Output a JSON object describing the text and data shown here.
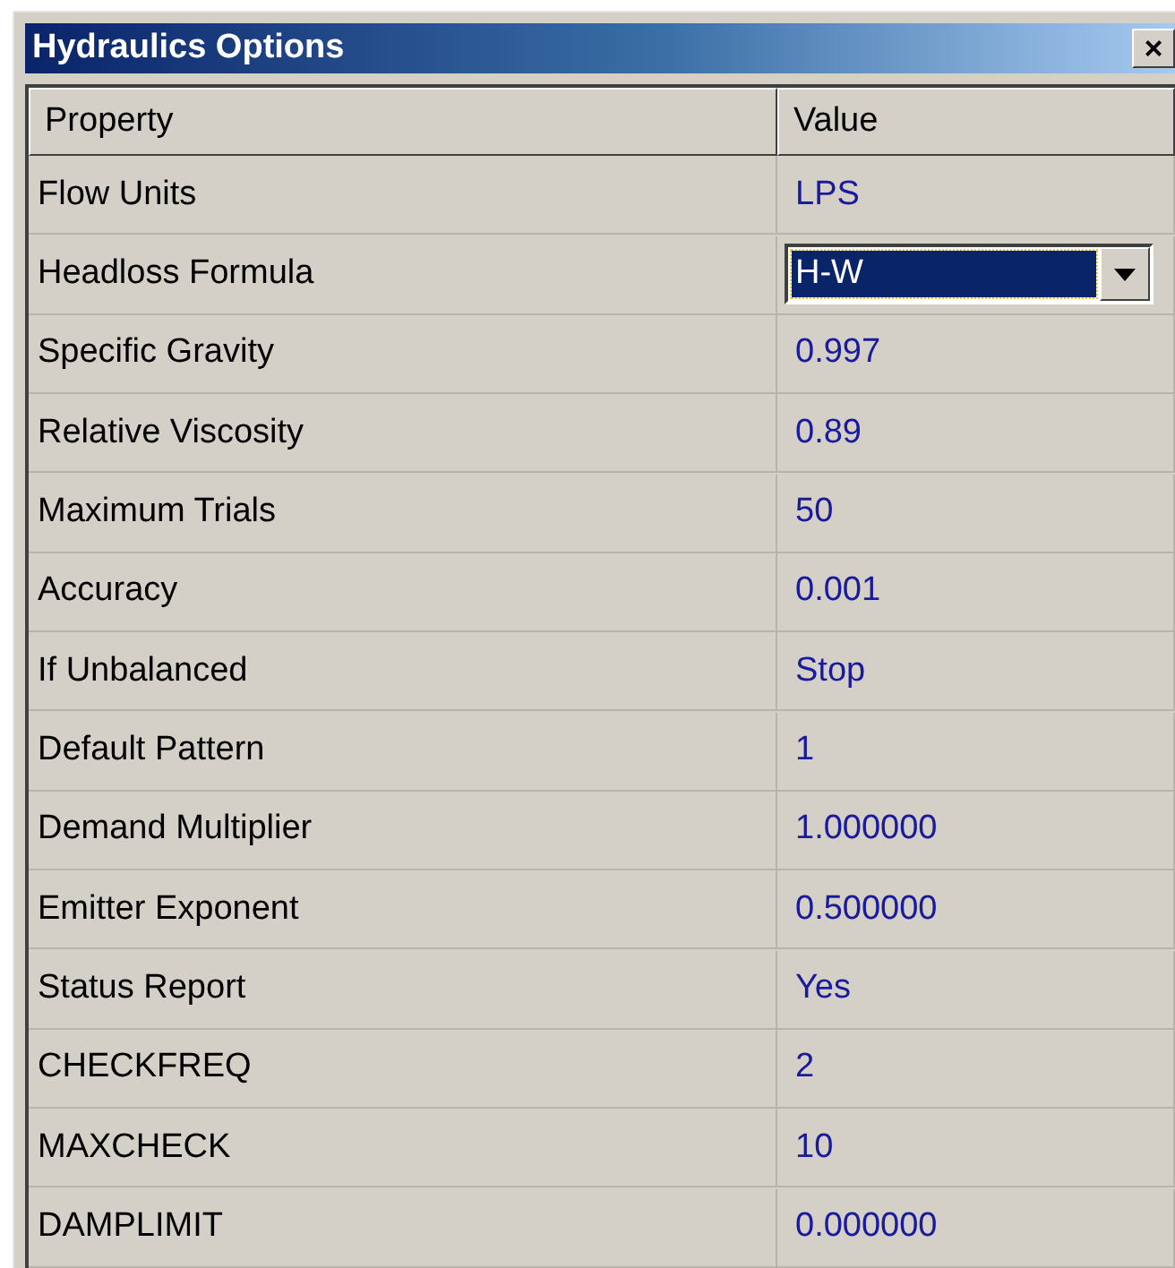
{
  "window": {
    "title": "Hydraulics Options",
    "close": "×"
  },
  "table": {
    "columns": [
      "Property",
      "Value"
    ],
    "rows": [
      {
        "kind": "text",
        "property": "Flow Units",
        "value": "LPS"
      },
      {
        "kind": "dropdown",
        "property": "Headloss Formula",
        "value": "H-W"
      },
      {
        "kind": "text",
        "property": "Specific Gravity",
        "value": "0.997"
      },
      {
        "kind": "text",
        "property": "Relative Viscosity",
        "value": "0.89"
      },
      {
        "kind": "text",
        "property": "Maximum Trials",
        "value": "50"
      },
      {
        "kind": "text",
        "property": "Accuracy",
        "value": "0.001"
      },
      {
        "kind": "text",
        "property": "If Unbalanced",
        "value": "Stop"
      },
      {
        "kind": "text",
        "property": "Default Pattern",
        "value": "1"
      },
      {
        "kind": "text",
        "property": "Demand Multiplier",
        "value": "1.000000"
      },
      {
        "kind": "text",
        "property": "Emitter Exponent",
        "value": "0.500000"
      },
      {
        "kind": "text",
        "property": "Status Report",
        "value": "Yes"
      },
      {
        "kind": "text",
        "property": "CHECKFREQ",
        "value": "2"
      },
      {
        "kind": "text",
        "property": "MAXCHECK",
        "value": "10"
      },
      {
        "kind": "text",
        "property": "DAMPLIMIT",
        "value": "0.000000"
      }
    ]
  }
}
